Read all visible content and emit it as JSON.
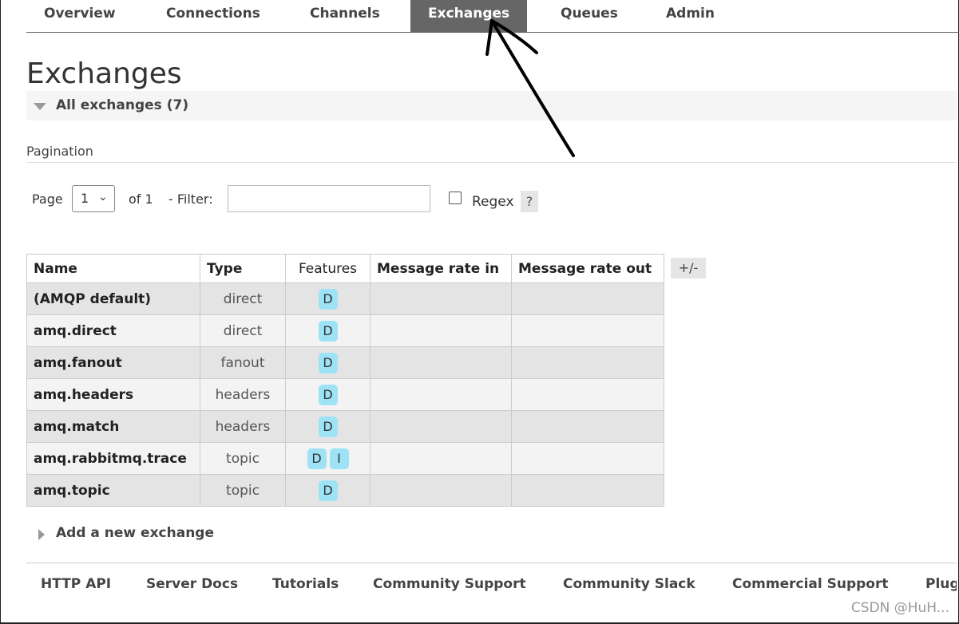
{
  "nav": {
    "tabs": [
      {
        "label": "Overview"
      },
      {
        "label": "Connections"
      },
      {
        "label": "Channels"
      },
      {
        "label": "Exchanges",
        "active": true
      },
      {
        "label": "Queues"
      },
      {
        "label": "Admin"
      }
    ]
  },
  "page": {
    "title": "Exchanges",
    "section_label": "All exchanges (7)"
  },
  "pagination": {
    "heading": "Pagination",
    "page_label": "Page",
    "page_value": "1",
    "of_label": "of 1",
    "filter_label": "- Filter:",
    "filter_value": "",
    "regex_label": "Regex",
    "help_label": "?"
  },
  "table": {
    "columns": [
      "Name",
      "Type",
      "Features",
      "Message rate in",
      "Message rate out"
    ],
    "column_toggle": "+/-",
    "rows": [
      {
        "name": "(AMQP default)",
        "type": "direct",
        "features": [
          "D"
        ]
      },
      {
        "name": "amq.direct",
        "type": "direct",
        "features": [
          "D"
        ]
      },
      {
        "name": "amq.fanout",
        "type": "fanout",
        "features": [
          "D"
        ]
      },
      {
        "name": "amq.headers",
        "type": "headers",
        "features": [
          "D"
        ]
      },
      {
        "name": "amq.match",
        "type": "headers",
        "features": [
          "D"
        ]
      },
      {
        "name": "amq.rabbitmq.trace",
        "type": "topic",
        "features": [
          "D",
          "I"
        ]
      },
      {
        "name": "amq.topic",
        "type": "topic",
        "features": [
          "D"
        ]
      }
    ]
  },
  "add_exchange": {
    "label": "Add a new exchange"
  },
  "footer": {
    "links": [
      "HTTP API",
      "Server Docs",
      "Tutorials",
      "Community Support",
      "Community Slack",
      "Commercial Support",
      "Plug"
    ]
  },
  "watermark": "CSDN @HuH..."
}
